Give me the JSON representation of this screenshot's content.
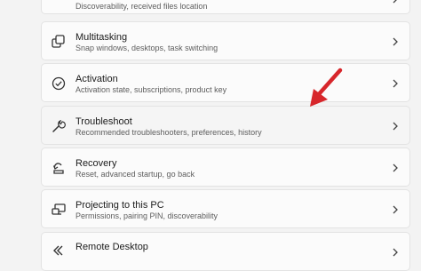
{
  "items": [
    {
      "title": "",
      "desc": "Discoverability, received files location",
      "icon": "share-icon"
    },
    {
      "title": "Multitasking",
      "desc": "Snap windows, desktops, task switching",
      "icon": "multitasking-icon"
    },
    {
      "title": "Activation",
      "desc": "Activation state, subscriptions, product key",
      "icon": "activation-check-icon"
    },
    {
      "title": "Troubleshoot",
      "desc": "Recommended troubleshooters, preferences, history",
      "icon": "wrench-icon"
    },
    {
      "title": "Recovery",
      "desc": "Reset, advanced startup, go back",
      "icon": "recovery-icon"
    },
    {
      "title": "Projecting to this PC",
      "desc": "Permissions, pairing PIN, discoverability",
      "icon": "projecting-icon"
    },
    {
      "title": "Remote Desktop",
      "desc": "",
      "icon": "remote-desktop-icon"
    }
  ],
  "annotation": {
    "color": "#d7262b",
    "icon": "red-arrow-annotation"
  }
}
